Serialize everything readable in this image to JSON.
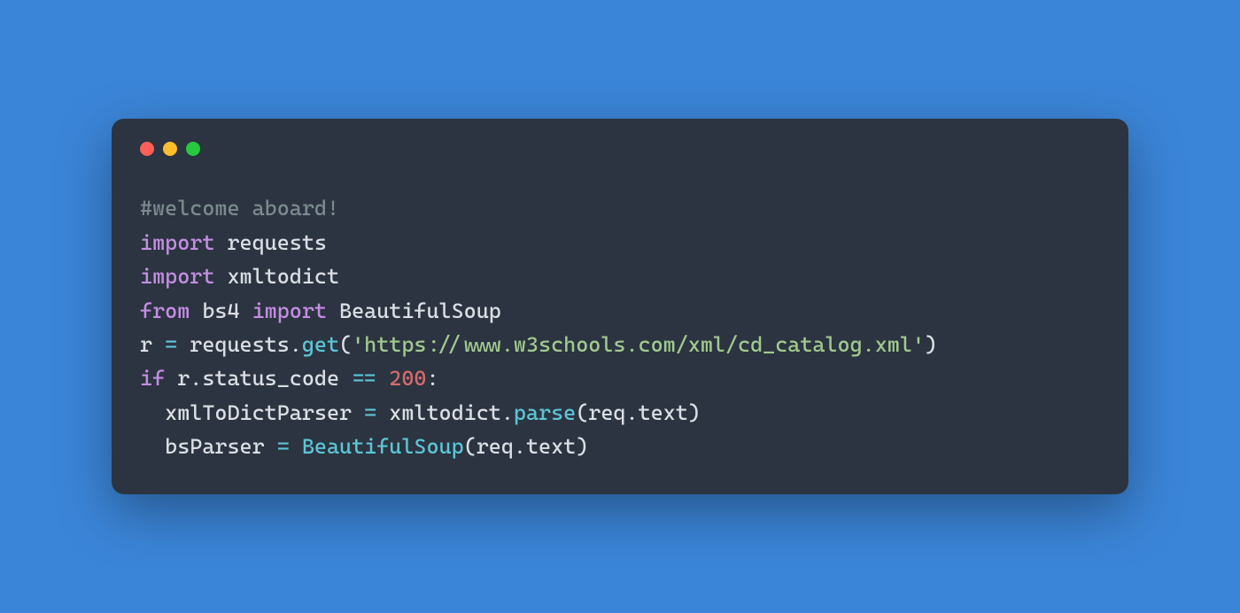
{
  "window": {
    "controls": {
      "close_color": "#ff5f56",
      "minimize_color": "#ffbd2e",
      "maximize_color": "#27c93f"
    }
  },
  "code": {
    "line1": {
      "comment": "#welcome aboard!"
    },
    "line2": {
      "keyword": "import",
      "space": " ",
      "module": "requests"
    },
    "line3": {
      "keyword": "import",
      "space": " ",
      "module": "xmltodict"
    },
    "line4": {
      "keyword_from": "from",
      "space1": " ",
      "module": "bs4",
      "space2": " ",
      "keyword_import": "import",
      "space3": " ",
      "name": "BeautifulSoup"
    },
    "line5": {
      "var": "r",
      "space1": " ",
      "assign": "=",
      "space2": " ",
      "obj": "requests",
      "dot": ".",
      "method": "get",
      "open": "(",
      "string": "'https://www.w3schools.com/xml/cd_catalog.xml'",
      "close": ")"
    },
    "line6": {
      "keyword_if": "if",
      "space1": " ",
      "obj": "r",
      "dot": ".",
      "attr": "status_code",
      "space2": " ",
      "op": "==",
      "space3": " ",
      "num": "200",
      "colon": ":"
    },
    "line7": {
      "indent": "  ",
      "var": "xmlToDictParser",
      "space1": " ",
      "assign": "=",
      "space2": " ",
      "obj": "xmltodict",
      "dot1": ".",
      "method": "parse",
      "open": "(",
      "arg_obj": "req",
      "dot2": ".",
      "arg_attr": "text",
      "close": ")"
    },
    "line8": {
      "indent": "  ",
      "var": "bsParser",
      "space1": " ",
      "assign": "=",
      "space2": " ",
      "func": "BeautifulSoup",
      "open": "(",
      "arg_obj": "req",
      "dot": ".",
      "arg_attr": "text",
      "close": ")"
    }
  }
}
